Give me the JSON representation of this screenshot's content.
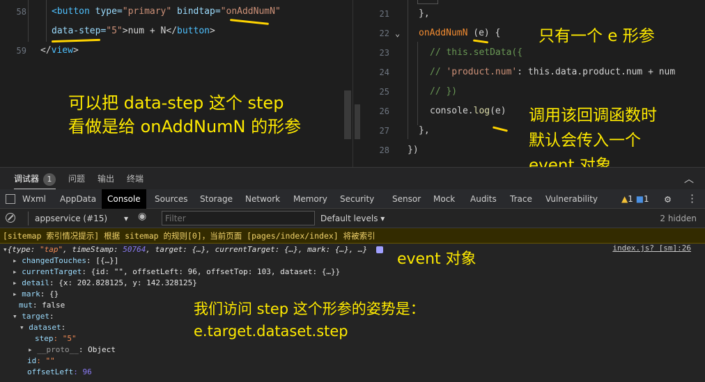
{
  "left_editor": {
    "lines": [
      {
        "num": "58",
        "t1": "<button",
        "t2": " type=",
        "t3": "\"primary\"",
        "t4": " bindtap=",
        "t5": "\"onAddNumN\""
      },
      {
        "num": "",
        "t1": "data-step=",
        "t2": "\"5\"",
        "t3": ">num + N</",
        "t4": "button",
        "t5": ">"
      },
      {
        "num": "59",
        "t1": "</",
        "t2": "view",
        "t3": ">"
      }
    ]
  },
  "right_editor": {
    "lines": [
      {
        "num": "21",
        "code": "},"
      },
      {
        "num": "22",
        "fn": "onAddNumN",
        "params": " (e) {"
      },
      {
        "num": "23",
        "code": "// this.setData({"
      },
      {
        "num": "24",
        "c1": "//   ",
        "c2": "'product.num'",
        "c3": ": this.data.product.num + num"
      },
      {
        "num": "25",
        "code": "// })"
      },
      {
        "num": "26",
        "fn": "console.",
        "call": "log",
        "args": "(e)"
      },
      {
        "num": "27",
        "code": "},"
      },
      {
        "num": "28",
        "code": "})"
      }
    ]
  },
  "notes": {
    "left_main_line1": "可以把 data-step 这个 step",
    "left_main_line2": "看做是给 onAddNumN 的形参",
    "right_top": "只有一个 e 形参",
    "right_mid_line1": "调用该回调函数时",
    "right_mid_line2": "默认会传入一个",
    "right_mid_line3": "event 对象",
    "console_event": "event 对象",
    "console_access_line1": "我们访问 step 这个形参的姿势是：",
    "console_access_line2": "e.target.dataset.step"
  },
  "panel": {
    "tabs": [
      {
        "label": "调试器",
        "badge": "1"
      },
      {
        "label": "问题"
      },
      {
        "label": "输出"
      },
      {
        "label": "终端"
      }
    ]
  },
  "devtools": {
    "tabs": [
      "Wxml",
      "AppData",
      "Console",
      "Sources",
      "Storage",
      "Network",
      "Memory",
      "Security",
      "Sensor",
      "Mock",
      "Audits",
      "Trace",
      "Vulnerability"
    ],
    "active_tab": "Console",
    "warn_count": "1",
    "info_count": "1"
  },
  "console": {
    "context": "appservice (#15)",
    "filter_placeholder": "Filter",
    "levels": "Default levels ▾",
    "hidden": "2 hidden",
    "warning": "[sitemap 索引情况提示] 根据 sitemap 的规则[0]，当前页面 [pages/index/index] 将被索引",
    "source_link": "index.js? [sm]:26",
    "summary": {
      "p1": "{type: ",
      "v1": "\"tap\"",
      "p2": ", timeStamp: ",
      "v2": "50764",
      "p3": ", target: {…}, currentTarget: {…}, mark: {…}, …}"
    },
    "rows": [
      {
        "key": "changedTouches",
        "val": ": [{…}]"
      },
      {
        "key": "currentTarget",
        "val": ": {id: \"\", offsetLeft: 96, offsetTop: 103, dataset: {…}}"
      },
      {
        "key": "detail",
        "val": ": {x: 202.828125, y: 142.328125}"
      },
      {
        "key": "mark",
        "val": ": {}"
      },
      {
        "key": "mut",
        "val": ": false"
      },
      {
        "key": "target",
        "val": ":"
      },
      {
        "key": "dataset",
        "val": ":"
      },
      {
        "key": "step",
        "val": ": \"5\""
      },
      {
        "key": "__proto__",
        "val": ": Object"
      },
      {
        "key": "id",
        "val": ": \"\""
      },
      {
        "key": "offsetLeft",
        "val": ": 96"
      }
    ]
  }
}
